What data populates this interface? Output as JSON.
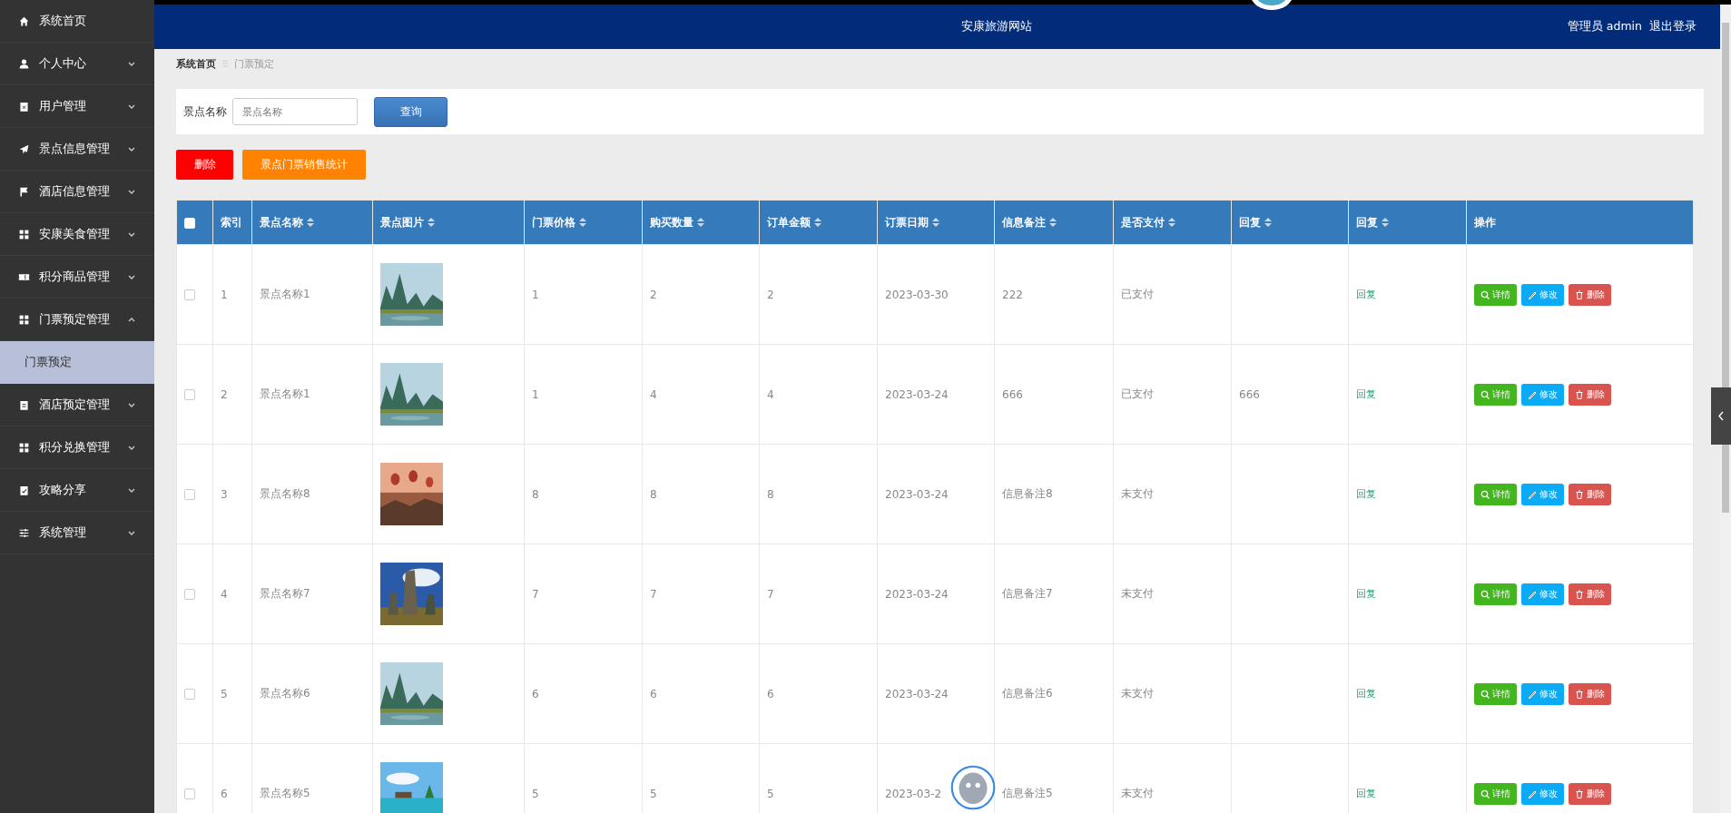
{
  "sidebar": {
    "items": [
      {
        "label": "系统首页"
      },
      {
        "label": "个人中心",
        "expanded": false
      },
      {
        "label": "用户管理",
        "expanded": false
      },
      {
        "label": "景点信息管理",
        "expanded": false
      },
      {
        "label": "酒店信息管理",
        "expanded": false
      },
      {
        "label": "安康美食管理",
        "expanded": false
      },
      {
        "label": "积分商品管理",
        "expanded": false
      },
      {
        "label": "门票预定管理",
        "expanded": true,
        "children": [
          {
            "label": "门票预定",
            "selected": true
          }
        ]
      },
      {
        "label": "酒店预定管理",
        "expanded": false
      },
      {
        "label": "积分兑换管理",
        "expanded": false
      },
      {
        "label": "攻略分享",
        "expanded": false
      },
      {
        "label": "系统管理",
        "expanded": false
      }
    ]
  },
  "header": {
    "title": "安康旅游网站",
    "user": "管理员 admin",
    "logout": "退出登录"
  },
  "breadcrumb": [
    "系统首页",
    "门票预定"
  ],
  "search": {
    "label": "景点名称",
    "placeholder": "景点名称",
    "button": "查询"
  },
  "actions": [
    {
      "label": "删除",
      "kind": "danger"
    },
    {
      "label": "景点门票销售统计",
      "kind": "warning"
    }
  ],
  "table": {
    "select_all": {
      "checked": false
    },
    "columns": [
      "索引",
      "景点名称",
      "景点图片",
      "门票价格",
      "购买数量",
      "订单金额",
      "订票日期",
      "信息备注",
      "是否支付",
      "回复",
      "回复",
      "操作"
    ],
    "rows": [
      {
        "checked": false,
        "cells": [
          "1",
          "景点名称1",
          {
            "kind": "picture"
          },
          "1",
          "2",
          "2",
          "2023-03-30",
          "222",
          "已支付",
          ""
        ],
        "link": "回复",
        "buttons": [
          "详情",
          "修改",
          "删除"
        ]
      },
      {
        "checked": false,
        "cells": [
          "2",
          "景点名称1",
          {
            "kind": "picture"
          },
          "1",
          "4",
          "4",
          "2023-03-24",
          "666",
          "已支付",
          "666"
        ],
        "link": "回复",
        "buttons": [
          "详情",
          "修改",
          "删除"
        ]
      },
      {
        "checked": false,
        "cells": [
          "3",
          "景点名称8",
          {
            "kind": "picture"
          },
          "8",
          "8",
          "8",
          "2023-03-24",
          "信息备注8",
          "未支付",
          ""
        ],
        "link": "回复",
        "buttons": [
          "详情",
          "修改",
          "删除"
        ]
      },
      {
        "checked": false,
        "cells": [
          "4",
          "景点名称7",
          {
            "kind": "picture"
          },
          "7",
          "7",
          "7",
          "2023-03-24",
          "信息备注7",
          "未支付",
          ""
        ],
        "link": "回复",
        "buttons": [
          "详情",
          "修改",
          "删除"
        ]
      },
      {
        "checked": false,
        "cells": [
          "5",
          "景点名称6",
          {
            "kind": "picture"
          },
          "6",
          "6",
          "6",
          "2023-03-24",
          "信息备注6",
          "未支付",
          ""
        ],
        "link": "回复",
        "buttons": [
          "详情",
          "修改",
          "删除"
        ]
      },
      {
        "checked": false,
        "cells": [
          "6",
          "景点名称5",
          {
            "kind": "picture"
          },
          "5",
          "5",
          "5",
          "2023-03-2",
          "信息备注5",
          "未支付",
          ""
        ],
        "link": "回复",
        "buttons": [
          "详情",
          "修改",
          "删除"
        ]
      }
    ]
  }
}
